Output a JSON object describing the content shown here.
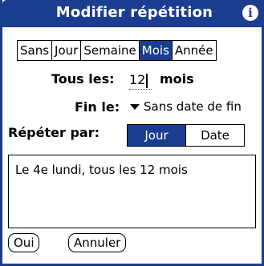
{
  "titlebar": {
    "title": "Modifier répétition",
    "info_icon": "info-icon",
    "color": "#1a3d8f"
  },
  "repeat_types": [
    {
      "label": "Sans",
      "selected": false
    },
    {
      "label": "Jour",
      "selected": false
    },
    {
      "label": "Semaine",
      "selected": false
    },
    {
      "label": "Mois",
      "selected": true
    },
    {
      "label": "Année",
      "selected": false
    }
  ],
  "every": {
    "label": "Tous les:",
    "value": "12",
    "unit": "mois"
  },
  "end": {
    "label": "Fin le:",
    "value": "Sans date de fin",
    "icon": "dropdown-arrow-icon"
  },
  "repeat_by": {
    "label": "Répéter par:",
    "options": [
      {
        "label": "Jour",
        "selected": true
      },
      {
        "label": "Date",
        "selected": false
      }
    ]
  },
  "description": "Le 4e lundi, tous les 12 mois",
  "buttons": {
    "ok": "Oui",
    "cancel": "Annuler"
  }
}
